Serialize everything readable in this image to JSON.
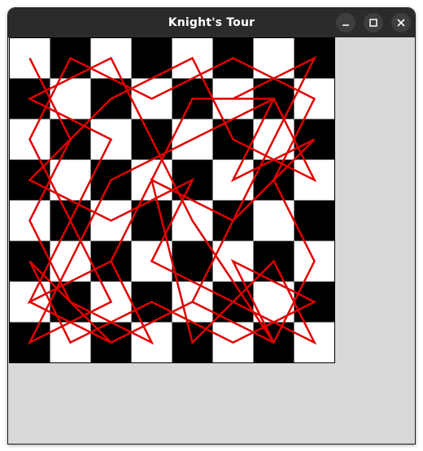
{
  "window": {
    "title": "Knight's Tour"
  },
  "titlebar_buttons": [
    {
      "name": "minimize",
      "icon": "minimize-icon"
    },
    {
      "name": "maximize",
      "icon": "maximize-icon"
    },
    {
      "name": "close",
      "icon": "close-icon"
    }
  ],
  "board": {
    "size": 8,
    "colors": {
      "light": "#ffffff",
      "dark": "#000000",
      "path": "#e00000",
      "background": "#d9d9d9"
    },
    "tour": [
      [
        0,
        0
      ],
      [
        1,
        2
      ],
      [
        0,
        4
      ],
      [
        1,
        6
      ],
      [
        3,
        7
      ],
      [
        2,
        5
      ],
      [
        0,
        6
      ],
      [
        1,
        4
      ],
      [
        0,
        2
      ],
      [
        1,
        0
      ],
      [
        3,
        1
      ],
      [
        5,
        0
      ],
      [
        7,
        1
      ],
      [
        6,
        3
      ],
      [
        7,
        5
      ],
      [
        6,
        7
      ],
      [
        4,
        6
      ],
      [
        2,
        7
      ],
      [
        0,
        5
      ],
      [
        1,
        7
      ],
      [
        3,
        6
      ],
      [
        5,
        7
      ],
      [
        7,
        6
      ],
      [
        5,
        5
      ],
      [
        6,
        7
      ],
      [
        4,
        4
      ],
      [
        3,
        2
      ],
      [
        2,
        0
      ],
      [
        0,
        1
      ],
      [
        2,
        2
      ],
      [
        1,
        4
      ],
      [
        2,
        6
      ],
      [
        0,
        7
      ],
      [
        1,
        5
      ],
      [
        2,
        3
      ],
      [
        4,
        2
      ],
      [
        6,
        1
      ],
      [
        7,
        3
      ],
      [
        5,
        2
      ],
      [
        4,
        0
      ],
      [
        2,
        1
      ],
      [
        0,
        3
      ],
      [
        2,
        4
      ],
      [
        4,
        3
      ],
      [
        3,
        5
      ],
      [
        5,
        6
      ],
      [
        7,
        7
      ],
      [
        6,
        5
      ],
      [
        4,
        7
      ],
      [
        3,
        3
      ],
      [
        5,
        4
      ],
      [
        7,
        2
      ],
      [
        5,
        3
      ],
      [
        6,
        1
      ],
      [
        4,
        1
      ],
      [
        3,
        3
      ],
      [
        2,
        5
      ],
      [
        0,
        6
      ],
      [
        2,
        7
      ],
      [
        4,
        6
      ],
      [
        5,
        4
      ],
      [
        6,
        2
      ],
      [
        7,
        0
      ],
      [
        5,
        1
      ]
    ]
  }
}
